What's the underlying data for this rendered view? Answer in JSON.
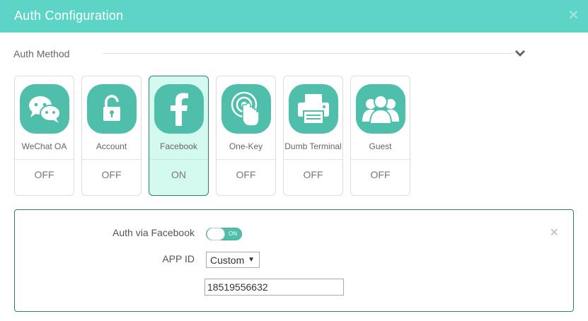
{
  "dialog": {
    "title": "Auth Configuration"
  },
  "section": {
    "label": "Auth Method"
  },
  "methods": [
    {
      "label": "WeChat OA",
      "state": "OFF",
      "icon": "wechat-icon"
    },
    {
      "label": "Account",
      "state": "OFF",
      "icon": "lock-icon"
    },
    {
      "label": "Facebook",
      "state": "ON",
      "icon": "facebook-icon"
    },
    {
      "label": "One-Key",
      "state": "OFF",
      "icon": "tap-icon"
    },
    {
      "label": "Dumb Terminal",
      "state": "OFF",
      "icon": "printer-icon"
    },
    {
      "label": "Guest",
      "state": "OFF",
      "icon": "guests-icon"
    }
  ],
  "facebook": {
    "auth_label": "Auth via Facebook",
    "toggle_text": "ON",
    "app_id_label": "APP ID",
    "app_id_select": "Custom",
    "app_id_value": "18519556632"
  },
  "colors": {
    "header": "#5dd5c6",
    "icon_bg": "#4fbfab",
    "active_border": "#2a7f72",
    "active_bg": "#d4f9ee"
  }
}
